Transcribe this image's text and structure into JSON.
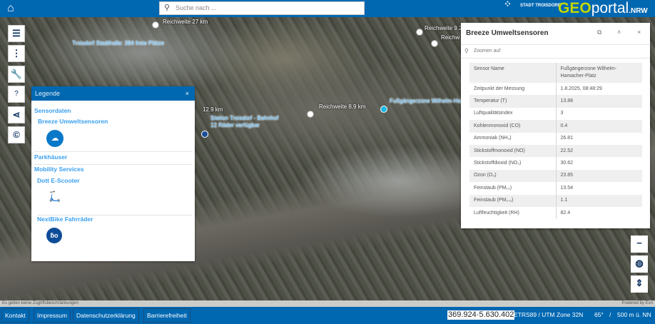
{
  "header": {
    "search_placeholder": "Suche nach ...",
    "city_logo": "STADT TROISDORF",
    "portal_logo_geo": "GEO",
    "portal_logo_portal": "portal",
    "portal_logo_nrw": ".NRW"
  },
  "map": {
    "labels": {
      "stadthalle": "Troisdorf Stadthalle: 384 freie Plätze",
      "station_name": "Station Troisdorf - Bahnhof",
      "station_bikes": "12 Räder verfügbar",
      "fussgaenger": "Fußgängerzone Wilhelm-Ha"
    },
    "range_labels": {
      "r1": "Reichweite 27 km",
      "r2": "Reichweite 9.2",
      "r3": "Reichw",
      "r4": "12.9 km",
      "r5": "Reichweite 8.9 km"
    }
  },
  "legend": {
    "title": "Legende",
    "close": "×",
    "sections": [
      {
        "label": "Sensordaten",
        "items": [
          {
            "label": "Breeze Umweltsensoren"
          }
        ]
      },
      {
        "label": "Parkhäuser"
      },
      {
        "label": "Mobility Services",
        "items": [
          {
            "label": "Dott E-Scooter"
          },
          {
            "label": "NextBike Fahrräder"
          }
        ]
      }
    ]
  },
  "panel": {
    "title": "Breeze Umweltsensoren",
    "zoom_label": "Zoomen auf",
    "rows": [
      {
        "k": "Sensor Name",
        "v": "Fußgängerzone Wilhelm-Hamacher-Platz"
      },
      {
        "k": "Zeitpunkt der Messung",
        "v": "1.8.2025, 08:48:29"
      },
      {
        "k": "Temperatur (T)",
        "v": "13.88"
      },
      {
        "k": "Luftqualitätsindex",
        "v": "3"
      },
      {
        "k": "Kohlenmonoxid (CO)",
        "v": "0.4"
      },
      {
        "k": "Ammoniak (NH₃)",
        "v": "26.81"
      },
      {
        "k": "Stickstoffmonoxid (NO)",
        "v": "22.52"
      },
      {
        "k": "Stickstoffdioxid (NO₂)",
        "v": "30.62"
      },
      {
        "k": "Ozon (O₃)",
        "v": "23.85"
      },
      {
        "k": "Feinstaub (PM₁₀)",
        "v": "13.54"
      },
      {
        "k": "Feinstaub (PM₂.₅)",
        "v": "1.1"
      },
      {
        "k": "Luftfeuchtigkeit (RH)",
        "v": "82.4"
      }
    ]
  },
  "attribution": {
    "left": "Es gelten keine Zugriffsbeschränkungen",
    "right": "Powered by Esri"
  },
  "footer": {
    "links": [
      "Kontakt",
      "Impressum",
      "Datenschutzerklärung",
      "Barrierefreiheit"
    ],
    "coordinates": "369.924·5.630.402",
    "crs": "ETRS89 / UTM Zone 32N",
    "tilt": "65°",
    "sep": "/",
    "height": "500 m ü. NN"
  },
  "colors": {
    "brand": "#0067b1",
    "accent": "#3aa0ef",
    "logo_green": "#c4d600"
  }
}
